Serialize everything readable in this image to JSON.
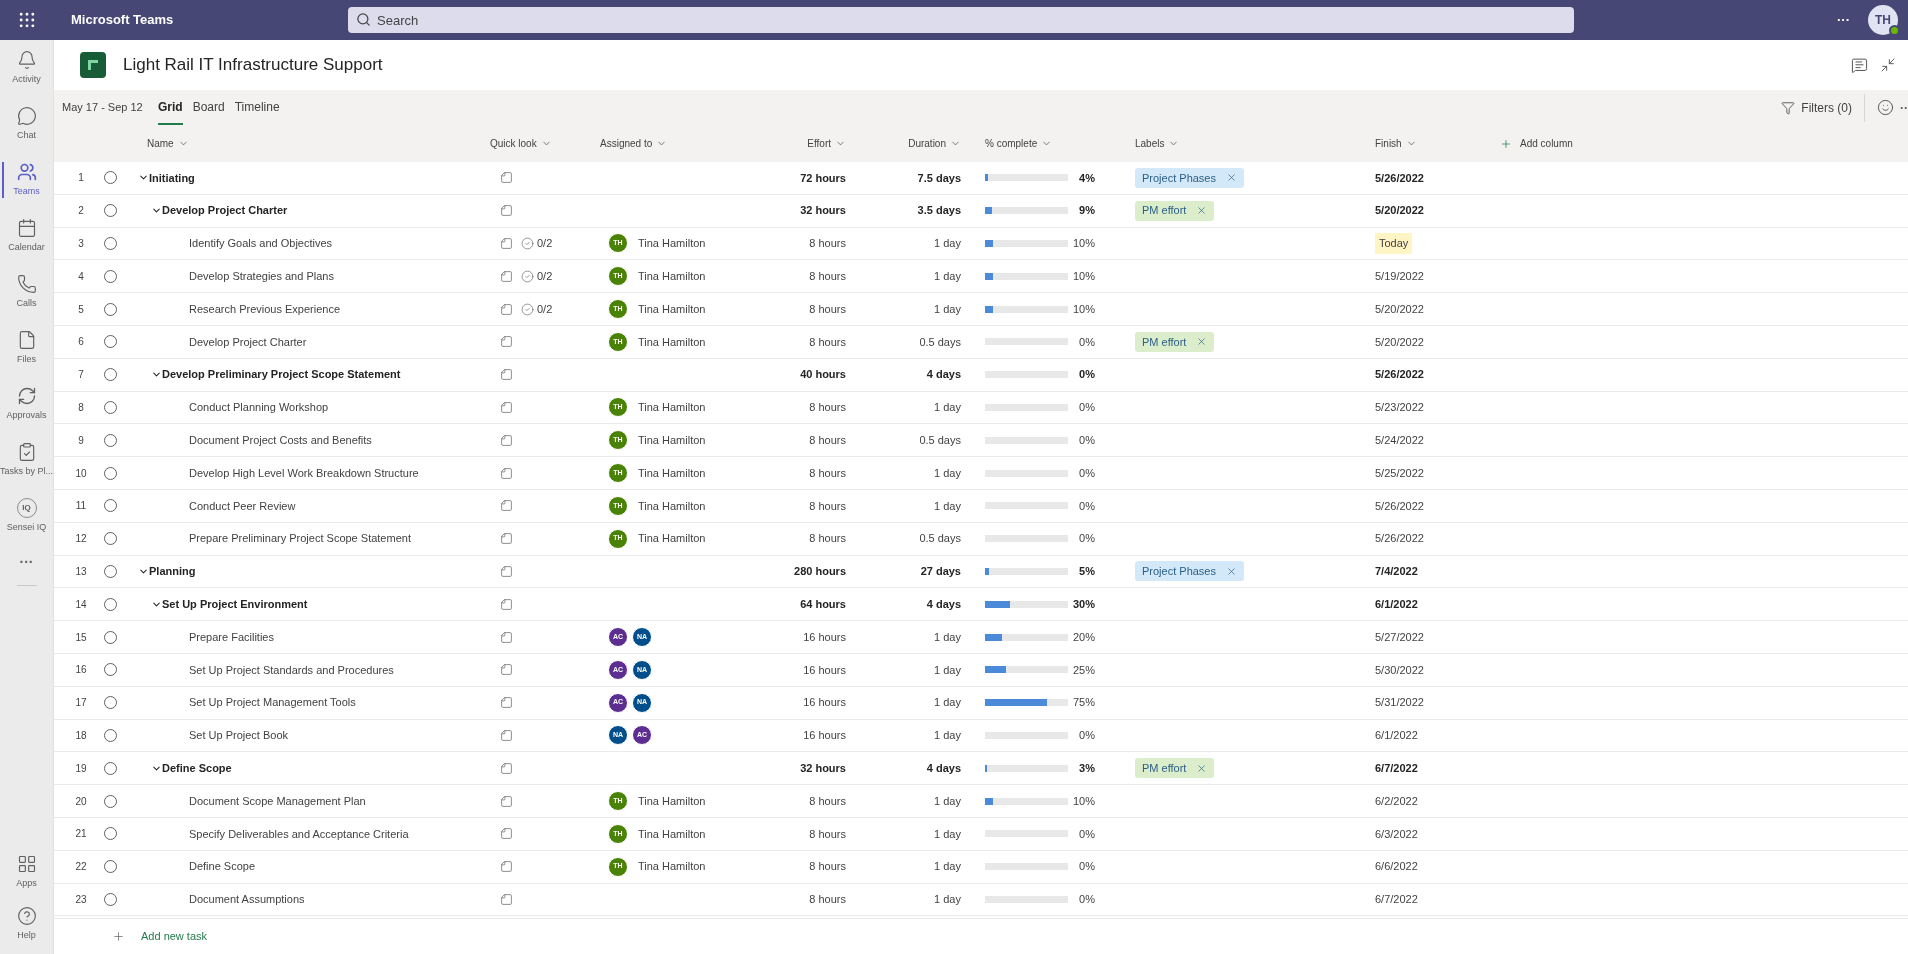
{
  "topbar": {
    "app_name": "Microsoft Teams",
    "search": {
      "placeholder": "Search"
    },
    "more": "···",
    "avatar": {
      "initials": "TH",
      "online": true
    }
  },
  "sidebar": {
    "items": [
      {
        "label": "Activity",
        "selected": false
      },
      {
        "label": "Chat",
        "selected": false
      },
      {
        "label": "Teams",
        "selected": true
      },
      {
        "label": "Calendar",
        "selected": false
      },
      {
        "label": "Calls",
        "selected": false
      },
      {
        "label": "Files",
        "selected": false
      },
      {
        "label": "Approvals",
        "selected": false
      },
      {
        "label": "Tasks by Pl...",
        "selected": false
      },
      {
        "label": "Sensei IQ",
        "icon_text": "IQ",
        "selected": false
      }
    ],
    "more": "···",
    "bottom_items": [
      {
        "label": "Apps"
      },
      {
        "label": "Help"
      }
    ]
  },
  "plan": {
    "title": "Light Rail IT Infrastructure Support"
  },
  "toolbar": {
    "date_range": "May 17 - Sep 12",
    "tabs": [
      {
        "label": "Grid",
        "selected": true
      },
      {
        "label": "Board",
        "selected": false
      },
      {
        "label": "Timeline",
        "selected": false
      }
    ],
    "filters": "Filters (0)",
    "more": "··"
  },
  "table": {
    "columns": [
      "Name",
      "Quick look",
      "Assigned to",
      "Effort",
      "Duration",
      "% complete",
      "Labels",
      "Finish"
    ],
    "add_column": "Add column",
    "rows": [
      {
        "num": "1",
        "name": "Initiating",
        "expanded": true,
        "completed": false,
        "effort": "72 hours",
        "duration": "7.5 days",
        "level": 0.04,
        "percent": "4%",
        "labels": [
          {
            "text": "Project Phases",
            "color": "#d3e8f8"
          }
        ],
        "finish": "5/26/2022",
        "due_today": false,
        "children": [
          {
            "num": "2",
            "name": "Develop Project Charter",
            "expanded": true,
            "completed": false,
            "effort": "32 hours",
            "duration": "3.5 days",
            "level": 0.09,
            "percent": "9%",
            "labels": [
              {
                "text": "PM effort",
                "color": "#dcedcc"
              }
            ],
            "finish": "5/20/2022",
            "due_today": false,
            "children": [
              {
                "num": "3",
                "name": "Identify Goals and Objectives",
                "completed": false,
                "checklist": "0/2",
                "assignees": [
                  {
                    "initials": "TH",
                    "name": "Tina Hamilton",
                    "color": "#498205"
                  }
                ],
                "effort": "8 hours",
                "duration": "1 day",
                "level": 0.1,
                "percent": "10%",
                "finish": "Today",
                "due_today": true
              },
              {
                "num": "4",
                "name": "Develop Strategies and Plans",
                "completed": false,
                "checklist": "0/2",
                "assignees": [
                  {
                    "initials": "TH",
                    "name": "Tina Hamilton",
                    "color": "#498205"
                  }
                ],
                "effort": "8 hours",
                "duration": "1 day",
                "level": 0.1,
                "percent": "10%",
                "finish": "5/19/2022",
                "due_today": false
              },
              {
                "num": "5",
                "name": "Research Previous Experience",
                "completed": false,
                "checklist": "0/2",
                "assignees": [
                  {
                    "initials": "TH",
                    "name": "Tina Hamilton",
                    "color": "#498205"
                  }
                ],
                "effort": "8 hours",
                "duration": "1 day",
                "level": 0.1,
                "percent": "10%",
                "finish": "5/20/2022",
                "due_today": false
              },
              {
                "num": "6",
                "name": "Develop Project Charter",
                "completed": false,
                "assignees": [
                  {
                    "initials": "TH",
                    "name": "Tina Hamilton",
                    "color": "#498205"
                  }
                ],
                "effort": "8 hours",
                "duration": "0.5 days",
                "level": 0,
                "percent": "0%",
                "labels": [
                  {
                    "text": "PM effort",
                    "color": "#dcedcc"
                  }
                ],
                "finish": "5/20/2022",
                "due_today": false
              }
            ]
          },
          {
            "num": "7",
            "name": "Develop Preliminary Project Scope Statement",
            "expanded": true,
            "completed": false,
            "effort": "40 hours",
            "duration": "4 days",
            "level": 0,
            "percent": "0%",
            "finish": "5/26/2022",
            "due_today": false,
            "children": [
              {
                "num": "8",
                "name": "Conduct Planning Workshop",
                "completed": false,
                "assignees": [
                  {
                    "initials": "TH",
                    "name": "Tina Hamilton",
                    "color": "#498205"
                  }
                ],
                "effort": "8 hours",
                "duration": "1 day",
                "level": 0,
                "percent": "0%",
                "finish": "5/23/2022",
                "due_today": false
              },
              {
                "num": "9",
                "name": "Document Project Costs and Benefits",
                "completed": false,
                "assignees": [
                  {
                    "initials": "TH",
                    "name": "Tina Hamilton",
                    "color": "#498205"
                  }
                ],
                "effort": "8 hours",
                "duration": "0.5 days",
                "level": 0,
                "percent": "0%",
                "finish": "5/24/2022",
                "due_today": false
              },
              {
                "num": "10",
                "name": "Develop High Level Work Breakdown Structure",
                "completed": false,
                "assignees": [
                  {
                    "initials": "TH",
                    "name": "Tina Hamilton",
                    "color": "#498205"
                  }
                ],
                "effort": "8 hours",
                "duration": "1 day",
                "level": 0,
                "percent": "0%",
                "finish": "5/25/2022",
                "due_today": false
              },
              {
                "num": "11",
                "name": "Conduct Peer Review",
                "completed": false,
                "assignees": [
                  {
                    "initials": "TH",
                    "name": "Tina Hamilton",
                    "color": "#498205"
                  }
                ],
                "effort": "8 hours",
                "duration": "1 day",
                "level": 0,
                "percent": "0%",
                "finish": "5/26/2022",
                "due_today": false
              },
              {
                "num": "12",
                "name": "Prepare Preliminary Project Scope Statement",
                "completed": false,
                "assignees": [
                  {
                    "initials": "TH",
                    "name": "Tina Hamilton",
                    "color": "#498205"
                  }
                ],
                "effort": "8 hours",
                "duration": "0.5 days",
                "level": 0,
                "percent": "0%",
                "finish": "5/26/2022",
                "due_today": false
              }
            ]
          }
        ]
      },
      {
        "num": "13",
        "name": "Planning",
        "expanded": true,
        "completed": false,
        "effort": "280 hours",
        "duration": "27 days",
        "level": 0.05,
        "percent": "5%",
        "labels": [
          {
            "text": "Project Phases",
            "color": "#d3e8f8"
          }
        ],
        "finish": "7/4/2022",
        "due_today": false,
        "children": [
          {
            "num": "14",
            "name": "Set Up Project Environment",
            "expanded": true,
            "completed": false,
            "effort": "64 hours",
            "duration": "4 days",
            "level": 0.3,
            "percent": "30%",
            "finish": "6/1/2022",
            "due_today": false,
            "children": [
              {
                "num": "15",
                "name": "Prepare Facilities",
                "completed": false,
                "assignees": [
                  {
                    "initials": "AC",
                    "color": "#5c2e91"
                  },
                  {
                    "initials": "NA",
                    "color": "#004e8c"
                  }
                ],
                "effort": "16 hours",
                "duration": "1 day",
                "level": 0.2,
                "percent": "20%",
                "finish": "5/27/2022",
                "due_today": false
              },
              {
                "num": "16",
                "name": "Set Up Project Standards and Procedures",
                "completed": false,
                "assignees": [
                  {
                    "initials": "AC",
                    "color": "#5c2e91"
                  },
                  {
                    "initials": "NA",
                    "color": "#004e8c"
                  }
                ],
                "effort": "16 hours",
                "duration": "1 day",
                "level": 0.25,
                "percent": "25%",
                "finish": "5/30/2022",
                "due_today": false
              },
              {
                "num": "17",
                "name": "Set Up Project Management Tools",
                "completed": false,
                "assignees": [
                  {
                    "initials": "AC",
                    "color": "#5c2e91"
                  },
                  {
                    "initials": "NA",
                    "color": "#004e8c"
                  }
                ],
                "effort": "16 hours",
                "duration": "1 day",
                "level": 0.75,
                "percent": "75%",
                "finish": "5/31/2022",
                "due_today": false
              },
              {
                "num": "18",
                "name": "Set Up Project Book",
                "completed": false,
                "assignees": [
                  {
                    "initials": "NA",
                    "color": "#004e8c"
                  },
                  {
                    "initials": "AC",
                    "color": "#5c2e91"
                  }
                ],
                "effort": "16 hours",
                "duration": "1 day",
                "level": 0,
                "percent": "0%",
                "finish": "6/1/2022",
                "due_today": false
              }
            ]
          },
          {
            "num": "19",
            "name": "Define Scope",
            "expanded": true,
            "completed": false,
            "effort": "32 hours",
            "duration": "4 days",
            "level": 0.03,
            "percent": "3%",
            "labels": [
              {
                "text": "PM effort",
                "color": "#dcedcc"
              }
            ],
            "finish": "6/7/2022",
            "due_today": false,
            "children": [
              {
                "num": "20",
                "name": "Document Scope Management Plan",
                "completed": false,
                "assignees": [
                  {
                    "initials": "TH",
                    "name": "Tina Hamilton",
                    "color": "#498205"
                  }
                ],
                "effort": "8 hours",
                "duration": "1 day",
                "level": 0.1,
                "percent": "10%",
                "finish": "6/2/2022",
                "due_today": false
              },
              {
                "num": "21",
                "name": "Specify Deliverables and Acceptance Criteria",
                "completed": false,
                "assignees": [
                  {
                    "initials": "TH",
                    "name": "Tina Hamilton",
                    "color": "#498205"
                  }
                ],
                "effort": "8 hours",
                "duration": "1 day",
                "level": 0,
                "percent": "0%",
                "finish": "6/3/2022",
                "due_today": false
              },
              {
                "num": "22",
                "name": "Define Scope",
                "completed": false,
                "assignees": [
                  {
                    "initials": "TH",
                    "name": "Tina Hamilton",
                    "color": "#498205"
                  }
                ],
                "effort": "8 hours",
                "duration": "1 day",
                "level": 0,
                "percent": "0%",
                "finish": "6/6/2022",
                "due_today": false
              },
              {
                "num": "23",
                "name": "Document Assumptions",
                "completed": false,
                "effort": "8 hours",
                "duration": "1 day",
                "level": 0,
                "percent": "0%",
                "finish": "6/7/2022",
                "due_today": false
              }
            ]
          }
        ]
      }
    ],
    "add_task": "Add new task"
  }
}
